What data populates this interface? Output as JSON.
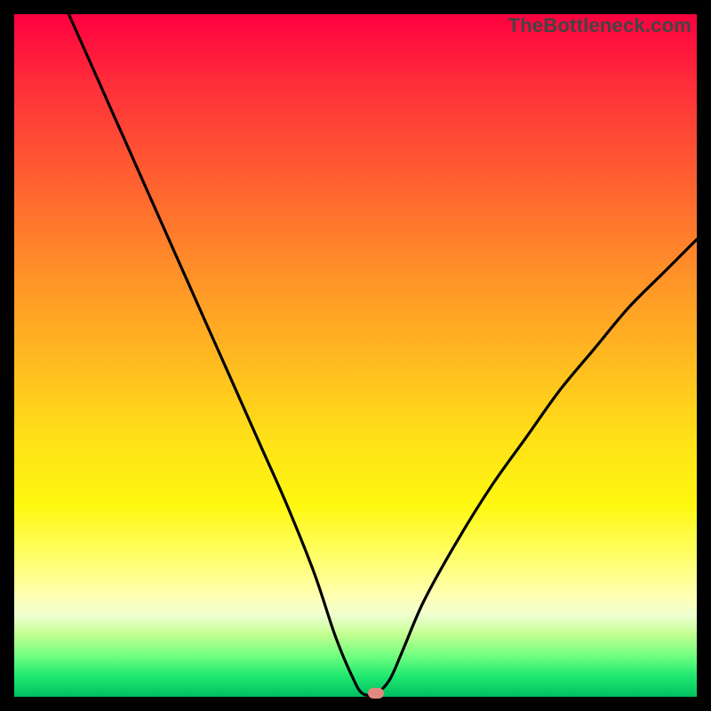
{
  "domain": "Chart",
  "attribution": "TheBottleneck.com",
  "colors": {
    "frame": "#000000",
    "curve": "#000000",
    "marker": "#e38a80",
    "gradient_top": "#ff0040",
    "gradient_bottom": "#00c060"
  },
  "chart_data": {
    "type": "line",
    "title": "",
    "xlabel": "",
    "ylabel": "",
    "x_range": [
      0,
      100
    ],
    "y_range": [
      0,
      100
    ],
    "note": "V-shaped bottleneck curve on red→green gradient. x is relative horizontal position (0–100), y is bottleneck severity (100=top/red, 0=bottom/green). Marker indicates optimal balance point.",
    "series": [
      {
        "name": "bottleneck-curve",
        "x": [
          8,
          12,
          16,
          20,
          24,
          28,
          32,
          36,
          40,
          44,
          47,
          49.5,
          51,
          53,
          55,
          57,
          60,
          65,
          70,
          75,
          80,
          85,
          90,
          95,
          100
        ],
        "y": [
          100,
          91,
          82,
          73,
          64,
          55,
          46,
          37,
          28,
          18,
          9,
          3,
          0.5,
          0.5,
          2.5,
          7,
          14,
          23,
          31,
          38,
          45,
          51,
          57,
          62,
          67
        ]
      }
    ],
    "marker": {
      "x": 53,
      "y": 0.5,
      "shape": "pill",
      "color": "#e38a80"
    }
  }
}
